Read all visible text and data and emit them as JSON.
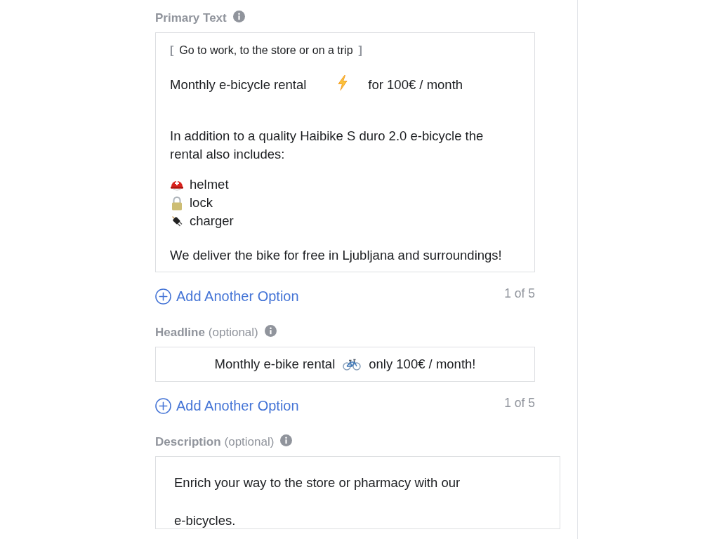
{
  "primary_text": {
    "label": "Primary Text",
    "tagline": {
      "open": "[",
      "text": "Go to work, to the store or on a trip",
      "close": "]"
    },
    "offer": {
      "before": "Monthly e-bicycle rental",
      "after": "for 100€ / month"
    },
    "intro": "In addition to a quality Haibike S duro 2.0 e-bicycle the rental also includes:",
    "includes": [
      "helmet",
      "lock",
      "charger"
    ],
    "closing": "We deliver the bike for free in Ljubljana and surroundings!",
    "add_option": "Add Another Option",
    "counter": "1 of 5"
  },
  "headline": {
    "label": "Headline",
    "note": "(optional)",
    "before": "Monthly e-bike rental",
    "after": "only 100€ / month!",
    "add_option": "Add Another Option",
    "counter": "1 of 5"
  },
  "description": {
    "label": "Description",
    "note": "(optional)",
    "lines": [
      "Enrich your way to the store or pharmacy with our",
      "e-bicycles."
    ]
  }
}
